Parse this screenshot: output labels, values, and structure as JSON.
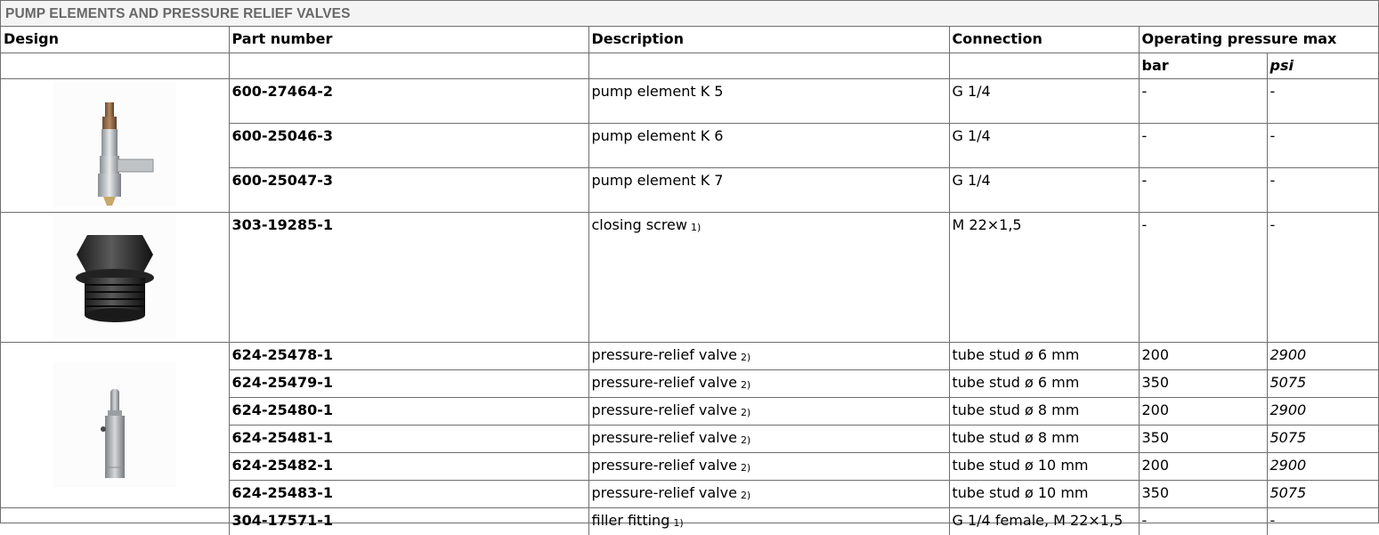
{
  "title": "PUMP ELEMENTS AND PRESSURE RELIEF VALVES",
  "headers": {
    "design": "Design",
    "part_number": "Part number",
    "description": "Description",
    "connection": "Connection",
    "operating_pressure": "Operating pressure max",
    "bar": "bar",
    "psi": "psi"
  },
  "rows": [
    {
      "part": "600-27464-2",
      "desc": "pump element K 5",
      "note": "",
      "conn": "G 1/4",
      "bar": "-",
      "psi": "-"
    },
    {
      "part": "600-25046-3",
      "desc": "pump element K 6",
      "note": "",
      "conn": "G 1/4",
      "bar": "-",
      "psi": "-"
    },
    {
      "part": "600-25047-3",
      "desc": "pump element K 7",
      "note": "",
      "conn": "G 1/4",
      "bar": "-",
      "psi": "-"
    },
    {
      "part": "303-19285-1",
      "desc": "closing screw",
      "note": "1)",
      "conn": "M 22×1,5",
      "bar": "-",
      "psi": "-"
    },
    {
      "part": "624-25478-1",
      "desc": "pressure-relief valve",
      "note": "2)",
      "conn": "tube stud ø 6 mm",
      "bar": "200",
      "psi": "2900"
    },
    {
      "part": "624-25479-1",
      "desc": "pressure-relief valve",
      "note": "2)",
      "conn": "tube stud ø 6 mm",
      "bar": "350",
      "psi": "5075"
    },
    {
      "part": "624-25480-1",
      "desc": "pressure-relief valve",
      "note": "2)",
      "conn": "tube stud ø 8 mm",
      "bar": "200",
      "psi": "2900"
    },
    {
      "part": "624-25481-1",
      "desc": "pressure-relief valve",
      "note": "2)",
      "conn": "tube stud ø 8 mm",
      "bar": "350",
      "psi": "5075"
    },
    {
      "part": "624-25482-1",
      "desc": "pressure-relief valve",
      "note": "2)",
      "conn": "tube stud ø 10 mm",
      "bar": "200",
      "psi": "2900"
    },
    {
      "part": "624-25483-1",
      "desc": "pressure-relief valve",
      "note": "2)",
      "conn": "tube stud ø 10 mm",
      "bar": "350",
      "psi": "5075"
    },
    {
      "part": "304-17571-1",
      "desc": "filler fitting",
      "note": "1)",
      "conn": "G 1/4 female, M 22×1,5",
      "bar": "-",
      "psi": "-"
    }
  ],
  "images": {
    "pump_element": "pump-element-photo",
    "closing_screw": "closing-screw-photo",
    "relief_valve": "pressure-relief-valve-photo"
  }
}
